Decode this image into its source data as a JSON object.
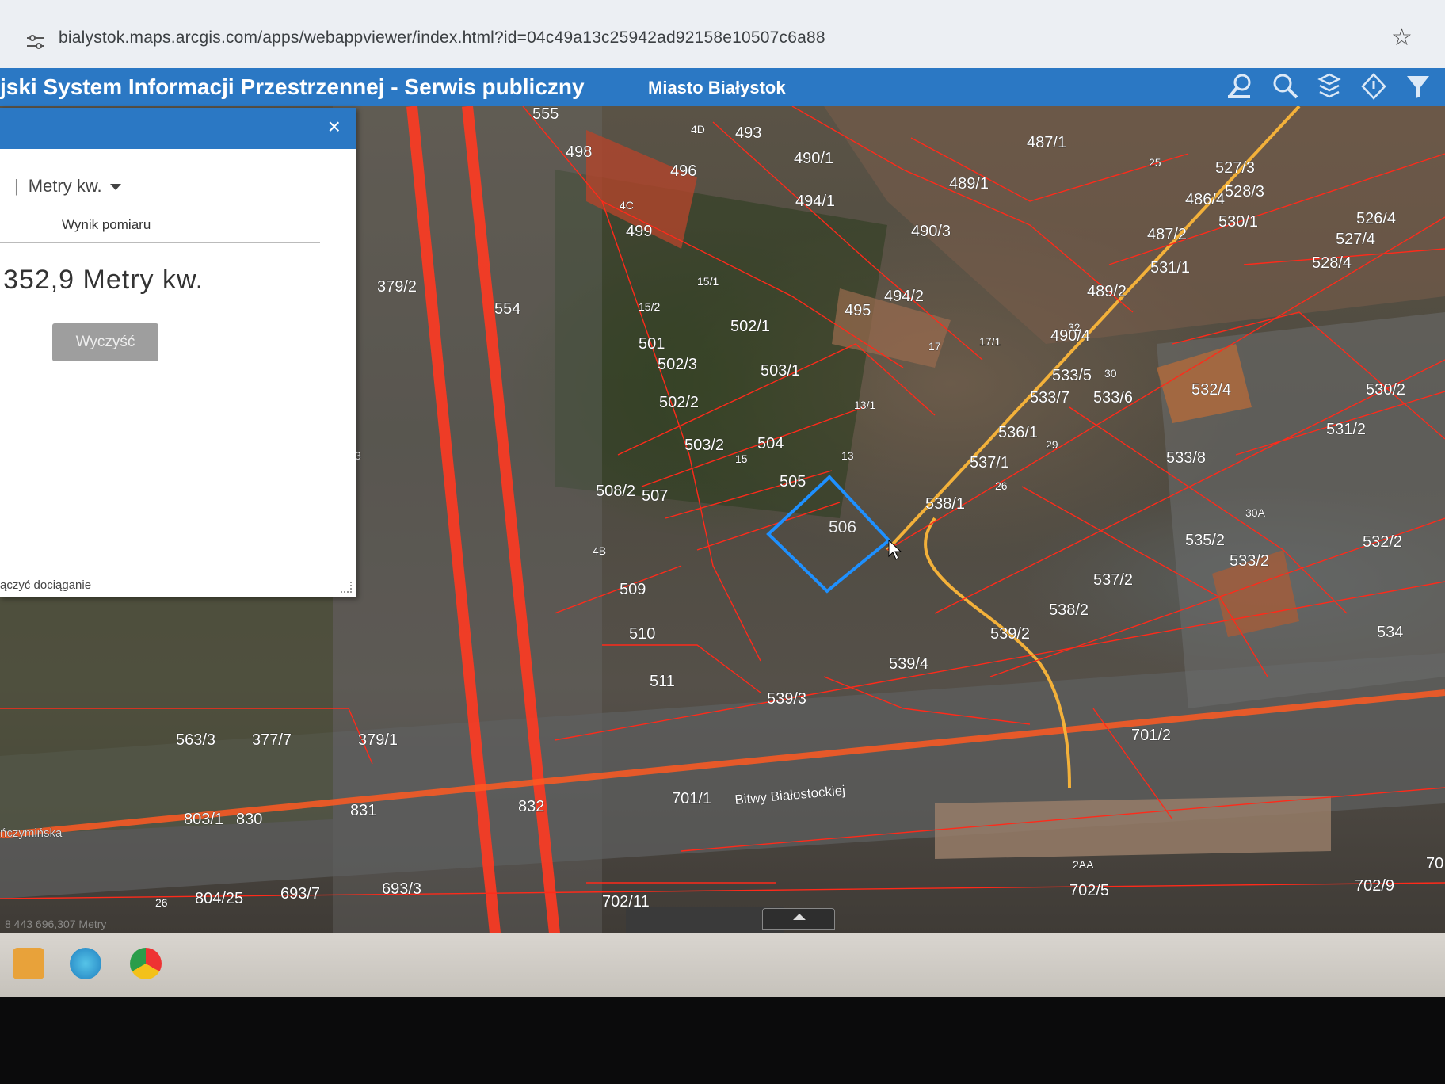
{
  "browser": {
    "url": "bialystok.maps.arcgis.com/apps/webappviewer/index.html?id=04c49a13c25942ad92158e10507c6a88",
    "icons": [
      "tune-icon",
      "star-icon"
    ]
  },
  "header": {
    "title": "jski System Informacji Przestrzennej - Serwis publiczny",
    "city": "Miasto Białystok",
    "tools": [
      "search-location-icon",
      "search-icon",
      "layers-icon",
      "measure-icon",
      "filter-icon"
    ],
    "accent": "#2b78c4"
  },
  "measure_panel": {
    "close": "×",
    "unit": "Metry kw.",
    "result_label": "Wynik pomiaru",
    "result_value": "352,9 Metry kw.",
    "clear_button": "Wyczyść",
    "snap_text": "ączyć dociąganie"
  },
  "map": {
    "street": "Bitwy Białostockiej",
    "selected_parcel": "506",
    "selection_color": "#1e90ff",
    "boundary_color": "#ff2a1a",
    "parcels": [
      "555",
      "498",
      "493",
      "4D",
      "490/1",
      "487/1",
      "496",
      "494/1",
      "489/1",
      "4C",
      "499",
      "490/3",
      "25",
      "527/3",
      "528/3",
      "486/4",
      "530/1",
      "487/2",
      "526/4",
      "527/4",
      "528/4",
      "531/1",
      "379/2",
      "554",
      "15/1",
      "15/2",
      "495",
      "494/2",
      "489/2",
      "501",
      "502/1",
      "502/3",
      "503/1",
      "17",
      "17/1",
      "490/4",
      "32",
      "533/5",
      "30",
      "502/2",
      "13/1",
      "533/7",
      "533/6",
      "532/4",
      "530/2",
      "536/1",
      "531/2",
      "503/2",
      "504",
      "29",
      "537/1",
      "533/8",
      "508/2",
      "507",
      "15",
      "13",
      "505",
      "506",
      "26",
      "538/1",
      "4B",
      "30A",
      "535/2",
      "532/2",
      "533/2",
      "509",
      "537/2",
      "510",
      "538/2",
      "539/2",
      "534",
      "539/4",
      "511",
      "539/3",
      "701/2",
      "563/3",
      "377/7",
      "379/1",
      "701/1",
      "832",
      "831",
      "803/1",
      "830",
      "2AA",
      "70",
      "702/5",
      "702/9",
      "693/3",
      "693/7",
      "804/25",
      "702/11",
      "26",
      "3"
    ],
    "coordinates": "8 443 696,307 Metry",
    "place_fragment": "ńczymińska"
  }
}
